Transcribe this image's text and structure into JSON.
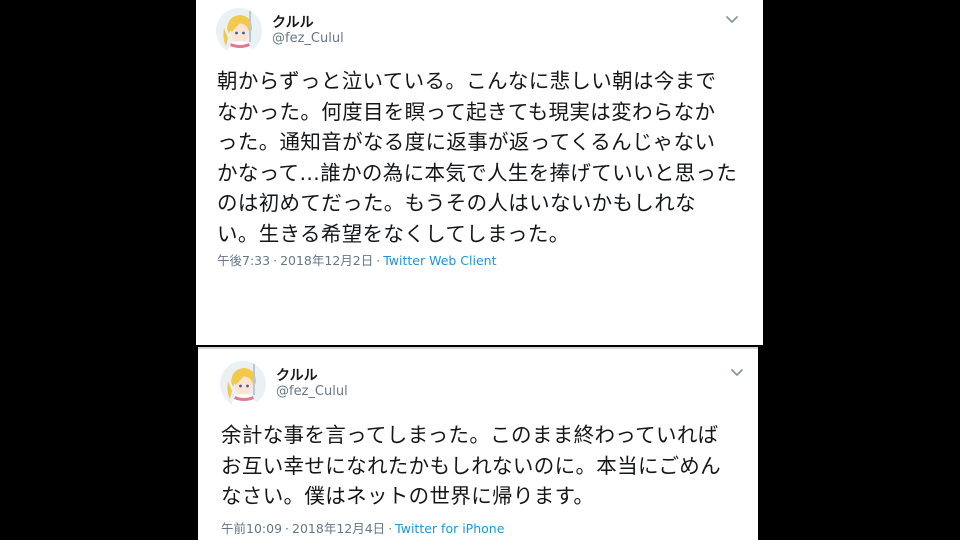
{
  "tweets": [
    {
      "display_name": "クルル",
      "handle": "@fez_Culul",
      "text_lines": [
        "朝からずっと泣いている。こんなに悲しい朝は今まで",
        "なかった。何度目を瞑って起きても現実は変わらなか",
        "った。通知音がなる度に返事が返ってくるんじゃない",
        "かなって…誰かの為に本気で人生を捧げていいと思った",
        "のは初めてだった。もうその人はいないかもしれな",
        "い。生きる希望をなくしてしまった。"
      ],
      "time": "午後7:33",
      "date": "2018年12月2日",
      "client": "Twitter Web Client"
    },
    {
      "display_name": "クルル",
      "handle": "@fez_Culul",
      "text_lines": [
        "余計な事を言ってしまった。このまま終わっていれば",
        "お互い幸せになれたかもしれないのに。本当にごめん",
        "なさい。僕はネットの世界に帰ります。"
      ],
      "time": "午前10:09",
      "date": "2018年12月4日",
      "client": "Twitter for iPhone"
    }
  ],
  "meta_separator": "·",
  "icons": {
    "avatar": "anime-character-avatar",
    "menu": "chevron-down-icon"
  },
  "colors": {
    "text": "#14171a",
    "secondary": "#657786",
    "link": "#1b95e0",
    "background": "#000000",
    "card": "#ffffff"
  }
}
